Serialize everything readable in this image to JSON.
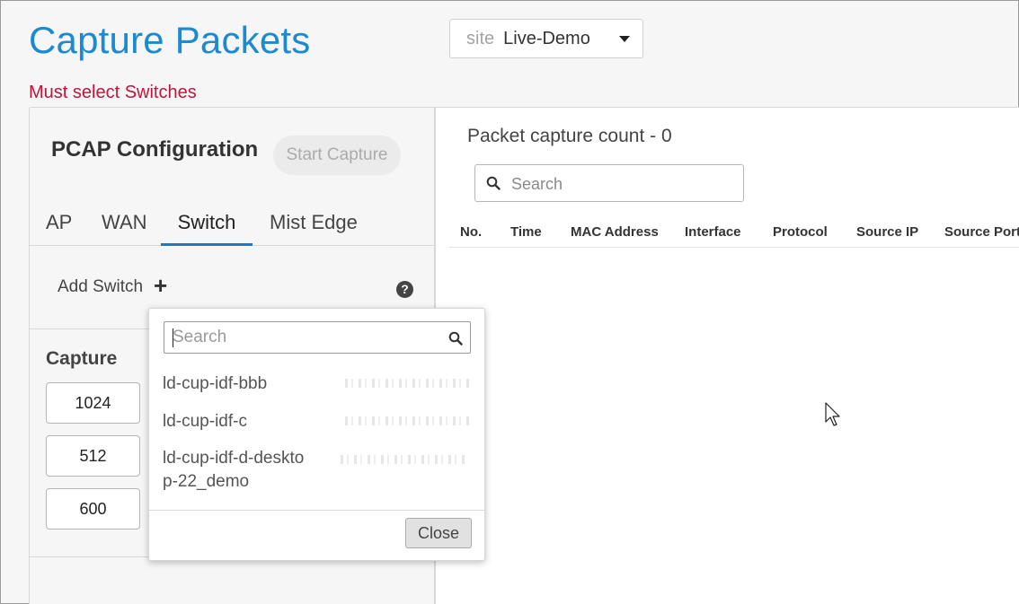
{
  "header": {
    "title": "Capture Packets",
    "site_label": "site",
    "site_value": "Live-Demo",
    "error": "Must select Switches"
  },
  "config": {
    "title": "PCAP Configuration",
    "start_label": "Start Capture",
    "tabs": [
      {
        "label": "AP",
        "active": false
      },
      {
        "label": "WAN",
        "active": false
      },
      {
        "label": "Switch",
        "active": true
      },
      {
        "label": "Mist Edge",
        "active": false
      }
    ],
    "add_switch_label": "Add Switch",
    "help_glyph": "?",
    "capture_label": "Capture",
    "capture_values": [
      "1024",
      "512",
      "600"
    ]
  },
  "results": {
    "count_text": "Packet capture count - 0",
    "search_placeholder": "Search",
    "columns": [
      "No.",
      "Time",
      "MAC Address",
      "Interface",
      "Protocol",
      "Source IP",
      "Source Port"
    ]
  },
  "switch_picker": {
    "search_placeholder": "Search",
    "items": [
      "ld-cup-idf-bbb",
      "ld-cup-idf-c",
      "ld-cup-idf-d-desktop-22_demo"
    ],
    "close_label": "Close"
  },
  "colors": {
    "title_blue": "#1b8ad3",
    "error_red": "#c0143c",
    "tab_active": "#1b7bc2"
  }
}
